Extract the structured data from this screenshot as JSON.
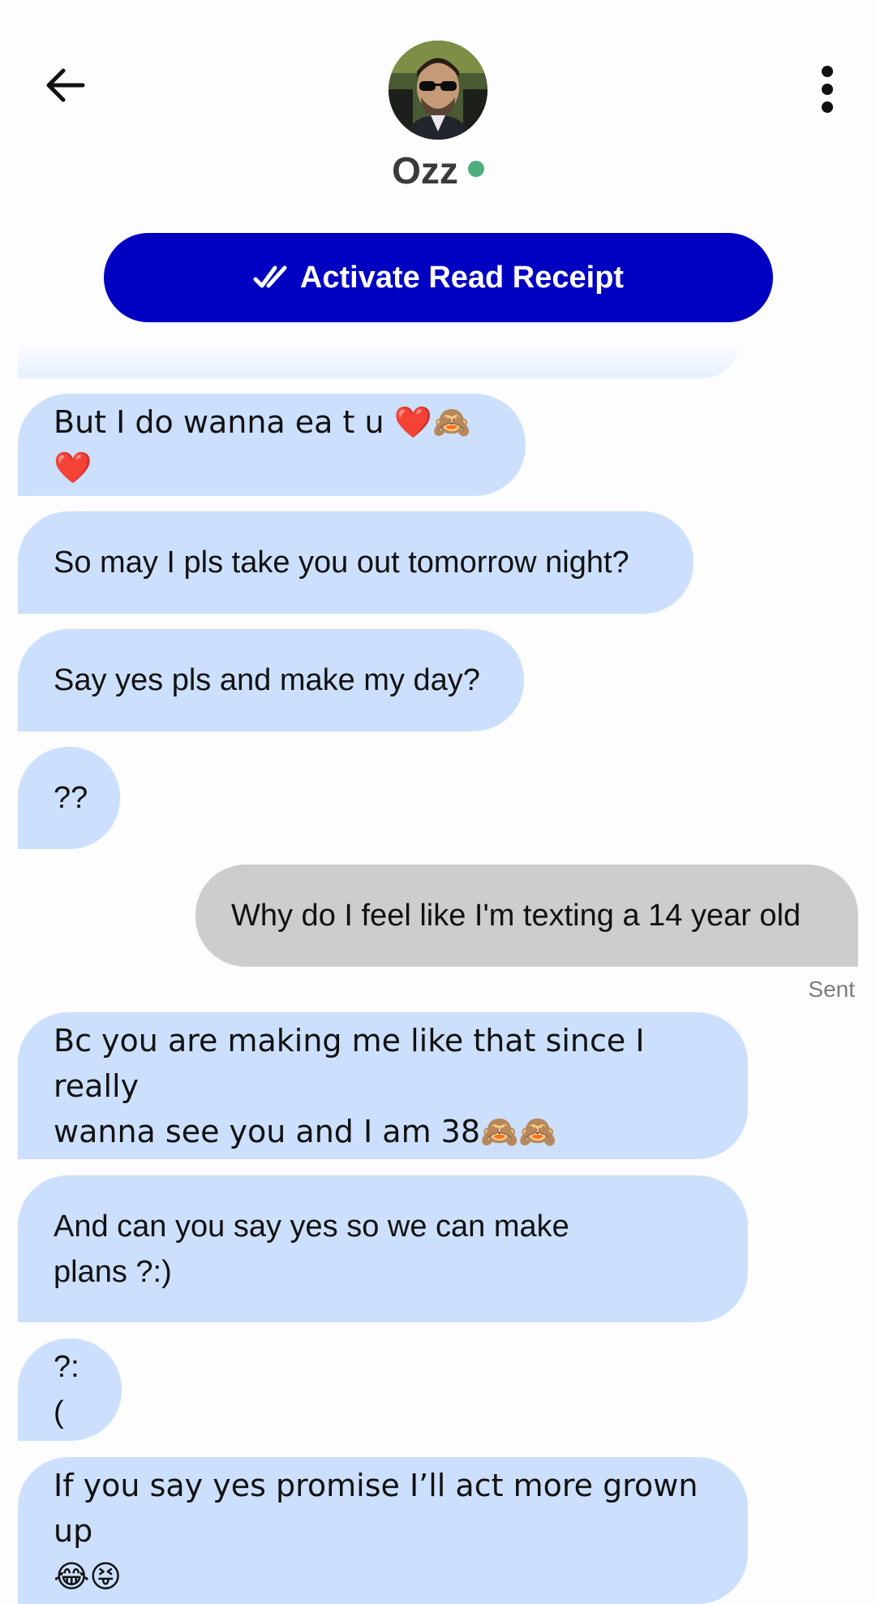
{
  "header": {
    "contact_name": "Ozz",
    "online_status_color": "#4caf7d",
    "back_icon": "arrow-left-icon",
    "menu_icon": "more-vertical-icon",
    "avatar_icon": "contact-avatar"
  },
  "read_receipt": {
    "label": "Activate Read Receipt",
    "icon": "double-check-icon",
    "color": "#0000c2"
  },
  "colors": {
    "incoming_bubble": "#cce0fd",
    "outgoing_bubble": "#cdcdcd"
  },
  "messages": [
    {
      "direction": "in",
      "text": "But I do wanna ea t u ❤️🙈❤️"
    },
    {
      "direction": "in",
      "text": "So may I pls take you out tomorrow night?"
    },
    {
      "direction": "in",
      "text": "Say yes pls and make my day?"
    },
    {
      "direction": "in",
      "text": "??"
    },
    {
      "direction": "out",
      "text": "Why do I feel like I'm texting a 14 year old",
      "status": "Sent"
    },
    {
      "direction": "in",
      "text": "Bc you are making me like that since I really\nwanna see you and I am 38🙈🙈"
    },
    {
      "direction": "in",
      "text": "And can you say yes so we can make\nplans ?:)"
    },
    {
      "direction": "in",
      "text": "?:("
    },
    {
      "direction": "in",
      "text": "If you say yes promise I’ll act more grown up\n😂😝"
    }
  ]
}
